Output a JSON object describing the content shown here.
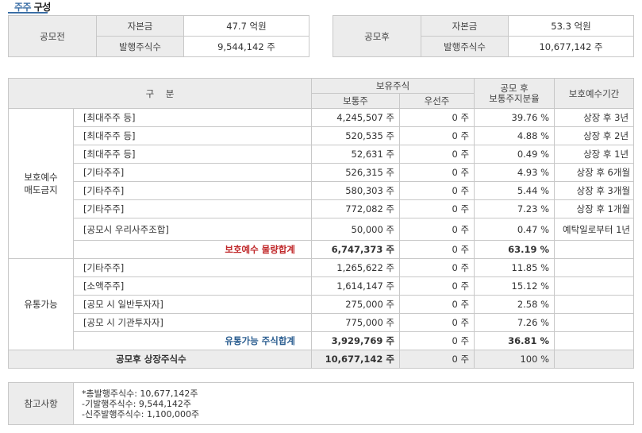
{
  "title": {
    "highlight": "주주",
    "rest": " 구성"
  },
  "capital": {
    "before": {
      "label": "공모전",
      "rows": [
        {
          "key": "자본금",
          "value": "47.7 억원"
        },
        {
          "key": "발행주식수",
          "value": "9,544,142 주"
        }
      ]
    },
    "after": {
      "label": "공모후",
      "rows": [
        {
          "key": "자본금",
          "value": "53.3 억원"
        },
        {
          "key": "발행주식수",
          "value": "10,677,142 주"
        }
      ]
    }
  },
  "table": {
    "headers": {
      "category": "구    분",
      "holdings": "보유주식",
      "common": "보통주",
      "preferred": "우선주",
      "ratio_line1": "공모 후",
      "ratio_line2": "보통주지분율",
      "lockup": "보호예수기간"
    },
    "groups": [
      {
        "label_line1": "보호예수",
        "label_line2": "매도금지",
        "rows": [
          {
            "name": "[최대주주 등]",
            "common": "4,245,507 주",
            "preferred": "0 주",
            "ratio": "39.76 %",
            "lockup": "상장 후 3년"
          },
          {
            "name": "[최대주주 등]",
            "common": "520,535 주",
            "preferred": "0 주",
            "ratio": "4.88 %",
            "lockup": "상장 후 2년"
          },
          {
            "name": "[최대주주 등]",
            "common": "52,631 주",
            "preferred": "0 주",
            "ratio": "0.49 %",
            "lockup": "상장 후 1년"
          },
          {
            "name": "[기타주주]",
            "common": "526,315 주",
            "preferred": "0 주",
            "ratio": "4.93 %",
            "lockup": "상장 후 6개월"
          },
          {
            "name": "[기타주주]",
            "common": "580,303 주",
            "preferred": "0 주",
            "ratio": "5.44 %",
            "lockup": "상장 후 3개월"
          },
          {
            "name": "[기타주주]",
            "common": "772,082 주",
            "preferred": "0 주",
            "ratio": "7.23 %",
            "lockup": "상장 후 1개월"
          },
          {
            "name": "[공모시 우리사주조합]",
            "common": "50,000 주",
            "preferred": "0 주",
            "ratio": "0.47 %",
            "lockup": "예탁일로부터 1년"
          }
        ],
        "subtotal": {
          "label": "보호예수 물량합계",
          "common": "6,747,373 주",
          "preferred": "0 주",
          "ratio": "63.19 %",
          "lockup": ""
        }
      },
      {
        "label_line1": "유통가능",
        "label_line2": "",
        "rows": [
          {
            "name": "[기타주주]",
            "common": "1,265,622 주",
            "preferred": "0 주",
            "ratio": "11.85 %",
            "lockup": ""
          },
          {
            "name": "[소액주주]",
            "common": "1,614,147 주",
            "preferred": "0 주",
            "ratio": "15.12 %",
            "lockup": ""
          },
          {
            "name": "[공모 시 일반투자자]",
            "common": "275,000 주",
            "preferred": "0 주",
            "ratio": "2.58 %",
            "lockup": ""
          },
          {
            "name": "[공모 시 기관투자자]",
            "common": "775,000 주",
            "preferred": "0 주",
            "ratio": "7.26 %",
            "lockup": ""
          }
        ],
        "subtotal": {
          "label": "유통가능 주식합계",
          "common": "3,929,769 주",
          "preferred": "0 주",
          "ratio": "36.81 %",
          "lockup": ""
        }
      }
    ],
    "grand_total": {
      "label": "공모후 상장주식수",
      "common": "10,677,142 주",
      "preferred": "0 주",
      "ratio": "100 %",
      "lockup": ""
    }
  },
  "notes": {
    "label": "참고사항",
    "lines": [
      "*총발행주식수: 10,677,142주",
      "-기발행주식수: 9,544,142주",
      "-신주발행주식수: 1,100,000주"
    ]
  },
  "colors": {
    "accent": "#3a6ea5",
    "protected_total": "#c0292b",
    "tradable_total": "#2d5f91",
    "header_bg": "#ececec"
  }
}
